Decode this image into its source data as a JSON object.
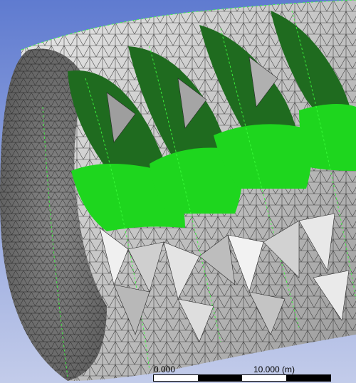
{
  "viewport": {
    "background_top": "#5f7bd0",
    "background_bottom": "#c3ccea",
    "mesh_face": "#c9c9c9",
    "mesh_edge": "#2a2a2a",
    "blade_dark": "#1f6b1f",
    "blade_light": "#1ed61e",
    "highlight_edge": "#3cff3c"
  },
  "scale": {
    "start_label": "0.000",
    "end_label": "10.000 (m)"
  }
}
